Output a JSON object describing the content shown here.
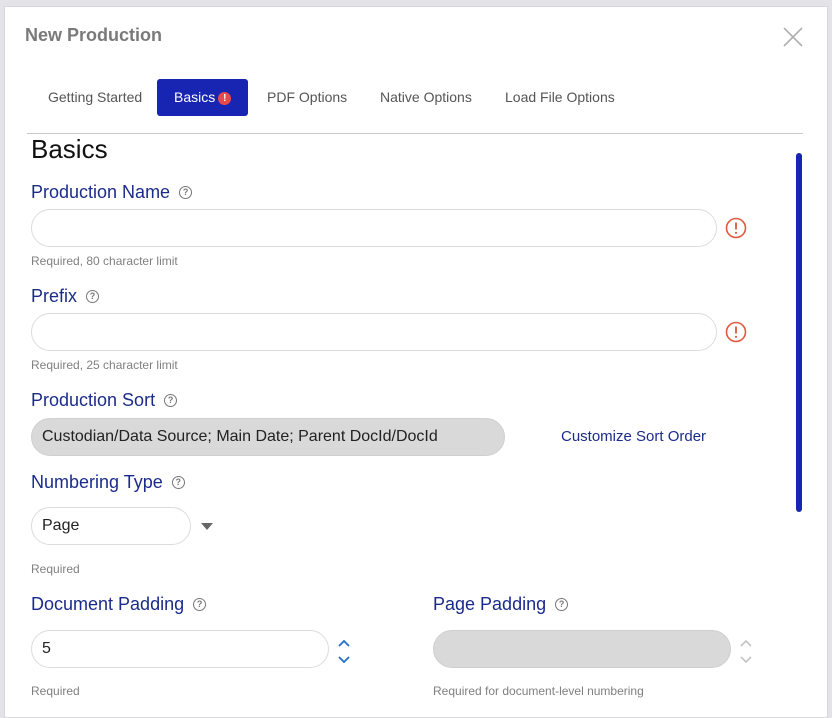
{
  "dialog": {
    "title": "New Production"
  },
  "tabs": [
    {
      "label": "Getting Started"
    },
    {
      "label": "Basics",
      "badge": "!"
    },
    {
      "label": "PDF Options"
    },
    {
      "label": "Native Options"
    },
    {
      "label": "Load File Options"
    }
  ],
  "section": {
    "title": "Basics"
  },
  "production_name": {
    "label": "Production Name",
    "help": "?",
    "value": "",
    "hint": "Required, 80 character limit"
  },
  "prefix": {
    "label": "Prefix",
    "help": "?",
    "value": "",
    "hint": "Required, 25 character limit"
  },
  "production_sort": {
    "label": "Production Sort",
    "help": "?",
    "value": "Custodian/Data Source; Main Date; Parent DocId/DocId",
    "link": "Customize Sort Order"
  },
  "numbering_type": {
    "label": "Numbering Type",
    "help": "?",
    "value": "Page",
    "hint": "Required"
  },
  "document_padding": {
    "label": "Document Padding",
    "help": "?",
    "value": "5",
    "hint": "Required"
  },
  "page_padding": {
    "label": "Page Padding",
    "help": "?",
    "value": "",
    "hint": "Required for document-level numbering"
  },
  "colors": {
    "accent": "#1725b2",
    "label": "#1b2b8c",
    "warning": "#e2583e",
    "badge": "#e8494b"
  }
}
